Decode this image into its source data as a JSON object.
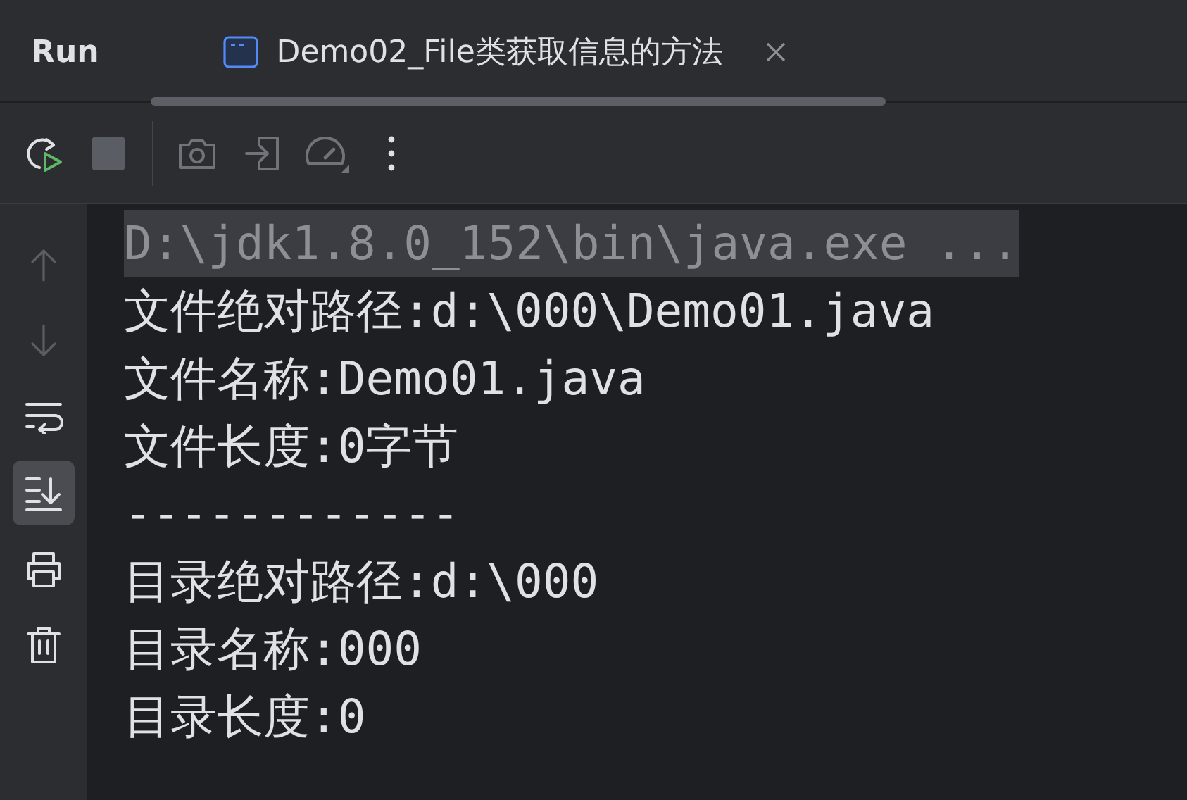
{
  "header": {
    "title": "Run",
    "tab": {
      "label": "Demo02_File类获取信息的方法",
      "selected": true
    }
  },
  "toolbar": [
    {
      "kind": "rerun",
      "disabled": false
    },
    {
      "kind": "stop",
      "disabled": true
    },
    {
      "kind": "separator"
    },
    {
      "kind": "camera",
      "disabled": true
    },
    {
      "kind": "exit",
      "disabled": true
    },
    {
      "kind": "gauge",
      "disabled": true
    },
    {
      "kind": "more",
      "disabled": false
    }
  ],
  "side_buttons": [
    {
      "kind": "up",
      "disabled": true,
      "selected": false
    },
    {
      "kind": "down",
      "disabled": true,
      "selected": false
    },
    {
      "kind": "wrap",
      "disabled": false,
      "selected": false
    },
    {
      "kind": "scroll-end",
      "disabled": false,
      "selected": true
    },
    {
      "kind": "print",
      "disabled": false,
      "selected": false
    },
    {
      "kind": "trash",
      "disabled": false,
      "selected": false
    }
  ],
  "console": [
    {
      "text": "D:\\jdk1.8.0_152\\bin\\java.exe ...",
      "kind": "command"
    },
    {
      "text": "文件绝对路径:d:\\000\\Demo01.java",
      "kind": "output"
    },
    {
      "text": "文件名称:Demo01.java",
      "kind": "output"
    },
    {
      "text": "文件长度:0字节",
      "kind": "output"
    },
    {
      "text": "------------",
      "kind": "output"
    },
    {
      "text": "目录绝对路径:d:\\000",
      "kind": "output"
    },
    {
      "text": "目录名称:000",
      "kind": "output"
    },
    {
      "text": "目录长度:0",
      "kind": "output"
    }
  ]
}
